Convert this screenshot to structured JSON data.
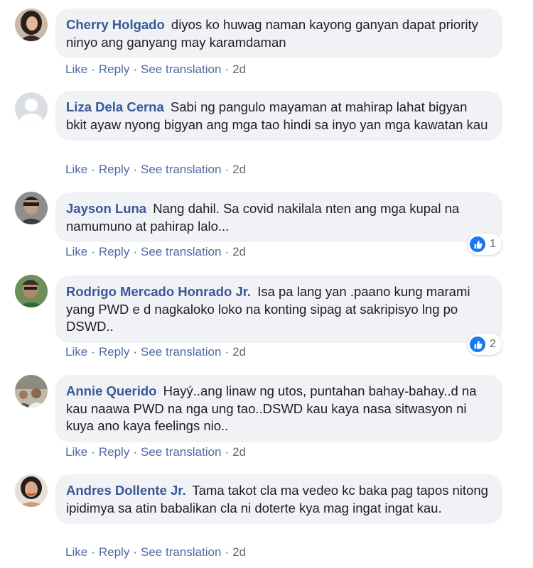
{
  "actions": {
    "like": "Like",
    "reply": "Reply",
    "see_translation": "See translation"
  },
  "comments": [
    {
      "author": "Cherry Holgado",
      "text": "diyos ko huwag naman kayong ganyan dapat priority ninyo ang ganyang may karamdaman",
      "time": "2d",
      "reactions": ""
    },
    {
      "author": "Liza Dela Cerna",
      "text": "Sabi ng pangulo mayaman at mahirap lahat bigyan bkit ayaw nyong bigyan ang mga tao hindi sa inyo yan mga kawatan kau",
      "time": "2d",
      "reactions": ""
    },
    {
      "author": "Jayson Luna",
      "text": "Nang dahil. Sa covid nakilala nten ang mga kupal na namumuno at pahirap lalo...",
      "time": "2d",
      "reactions": "1"
    },
    {
      "author": "Rodrigo Mercado Honrado Jr.",
      "text": "Isa pa lang yan .paano kung marami yang PWD e d nagkaloko loko na konting sipag at sakripisyo lng po DSWD..",
      "time": "2d",
      "reactions": "2"
    },
    {
      "author": "Annie Querido",
      "text": "Hayý..ang linaw ng utos, puntahan bahay-bahay..d na kau naawa PWD na nga ung tao..DSWD kau kaya nasa sitwasyon ni kuya ano kaya feelings nio..",
      "time": "2d",
      "reactions": ""
    },
    {
      "author": "Andres Dollente Jr.",
      "text": "Tama takot cla ma vedeo kc baka pag tapos nitong ipidimya sa atin babalikan cla ni doterte kya mag ingat ingat kau.",
      "time": "2d",
      "reactions": ""
    }
  ]
}
